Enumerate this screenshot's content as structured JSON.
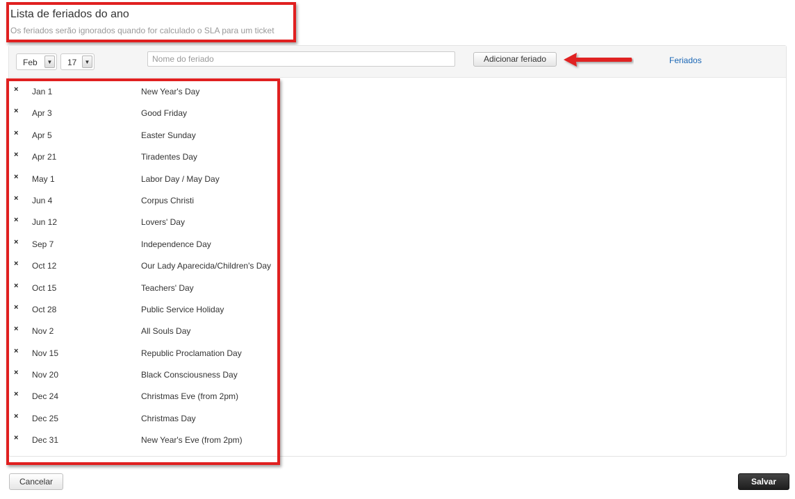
{
  "header": {
    "title": "Lista de feriados do ano",
    "subtitle": "Os feriados serão ignorados quando for calculado o SLA para um ticket"
  },
  "toolbar": {
    "month_select": {
      "value": "Feb",
      "arrow_icon": "chevron-down-icon"
    },
    "day_select": {
      "value": "17",
      "arrow_icon": "chevron-down-icon"
    },
    "name_input": {
      "value": "",
      "placeholder": "Nome do feriado"
    },
    "add_button_label": "Adicionar feriado",
    "feriados_link": "Feriados"
  },
  "holidays": [
    {
      "date": "Jan 1",
      "name": "New Year's Day"
    },
    {
      "date": "Apr 3",
      "name": "Good Friday"
    },
    {
      "date": "Apr 5",
      "name": "Easter Sunday"
    },
    {
      "date": "Apr 21",
      "name": "Tiradentes Day"
    },
    {
      "date": "May 1",
      "name": "Labor Day / May Day"
    },
    {
      "date": "Jun 4",
      "name": "Corpus Christi"
    },
    {
      "date": "Jun 12",
      "name": "Lovers' Day"
    },
    {
      "date": "Sep 7",
      "name": "Independence Day"
    },
    {
      "date": "Oct 12",
      "name": "Our Lady Aparecida/Children's Day"
    },
    {
      "date": "Oct 15",
      "name": "Teachers' Day"
    },
    {
      "date": "Oct 28",
      "name": "Public Service Holiday"
    },
    {
      "date": "Nov 2",
      "name": "All Souls Day"
    },
    {
      "date": "Nov 15",
      "name": "Republic Proclamation Day"
    },
    {
      "date": "Nov 20",
      "name": "Black Consciousness Day"
    },
    {
      "date": "Dec 24",
      "name": "Christmas Eve (from 2pm)"
    },
    {
      "date": "Dec 25",
      "name": "Christmas Day"
    },
    {
      "date": "Dec 31",
      "name": "New Year's Eve (from 2pm)"
    }
  ],
  "delete_icon": {
    "glyph": "×",
    "icon": "close-icon"
  },
  "footer": {
    "cancel_label": "Cancelar",
    "save_label": "Salvar"
  },
  "colors": {
    "annotation_red": "#e02020",
    "link_blue": "#1a66b5",
    "save_button_dark": "#222222"
  }
}
